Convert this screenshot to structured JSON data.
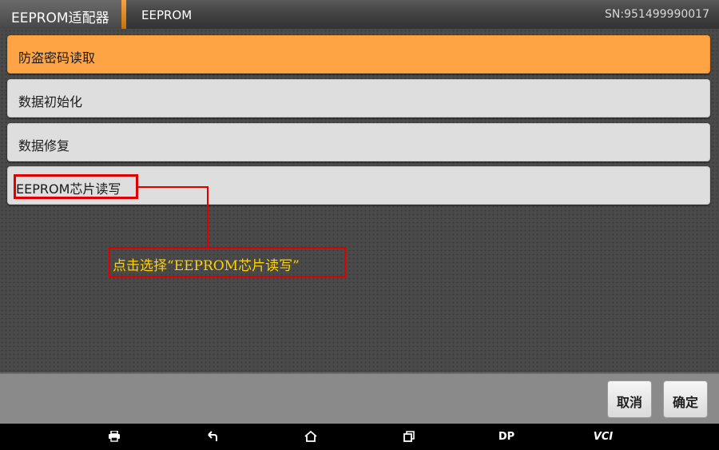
{
  "header": {
    "app_title": "EEPROM适配器",
    "breadcrumb": "EEPROM",
    "serial": "SN:951499990017"
  },
  "menu": {
    "items": [
      {
        "label": "防盗密码读取",
        "selected": true
      },
      {
        "label": "数据初始化",
        "selected": false
      },
      {
        "label": "数据修复",
        "selected": false
      },
      {
        "label": "EEPROM芯片读写",
        "selected": false
      }
    ]
  },
  "annotation": {
    "callout_text": "点击选择“EEPROM芯片读写”",
    "color": "#e00000",
    "text_color": "#ffd200"
  },
  "actions": {
    "cancel_label": "取消",
    "confirm_label": "确定"
  },
  "navbar": {
    "dp_label": "DP",
    "vci_label": "VCI",
    "icons": [
      "printer-icon",
      "back-icon",
      "home-icon",
      "recent-apps-icon"
    ]
  },
  "colors": {
    "accent": "#ffa445",
    "tab_edge": "#e18a1e"
  }
}
